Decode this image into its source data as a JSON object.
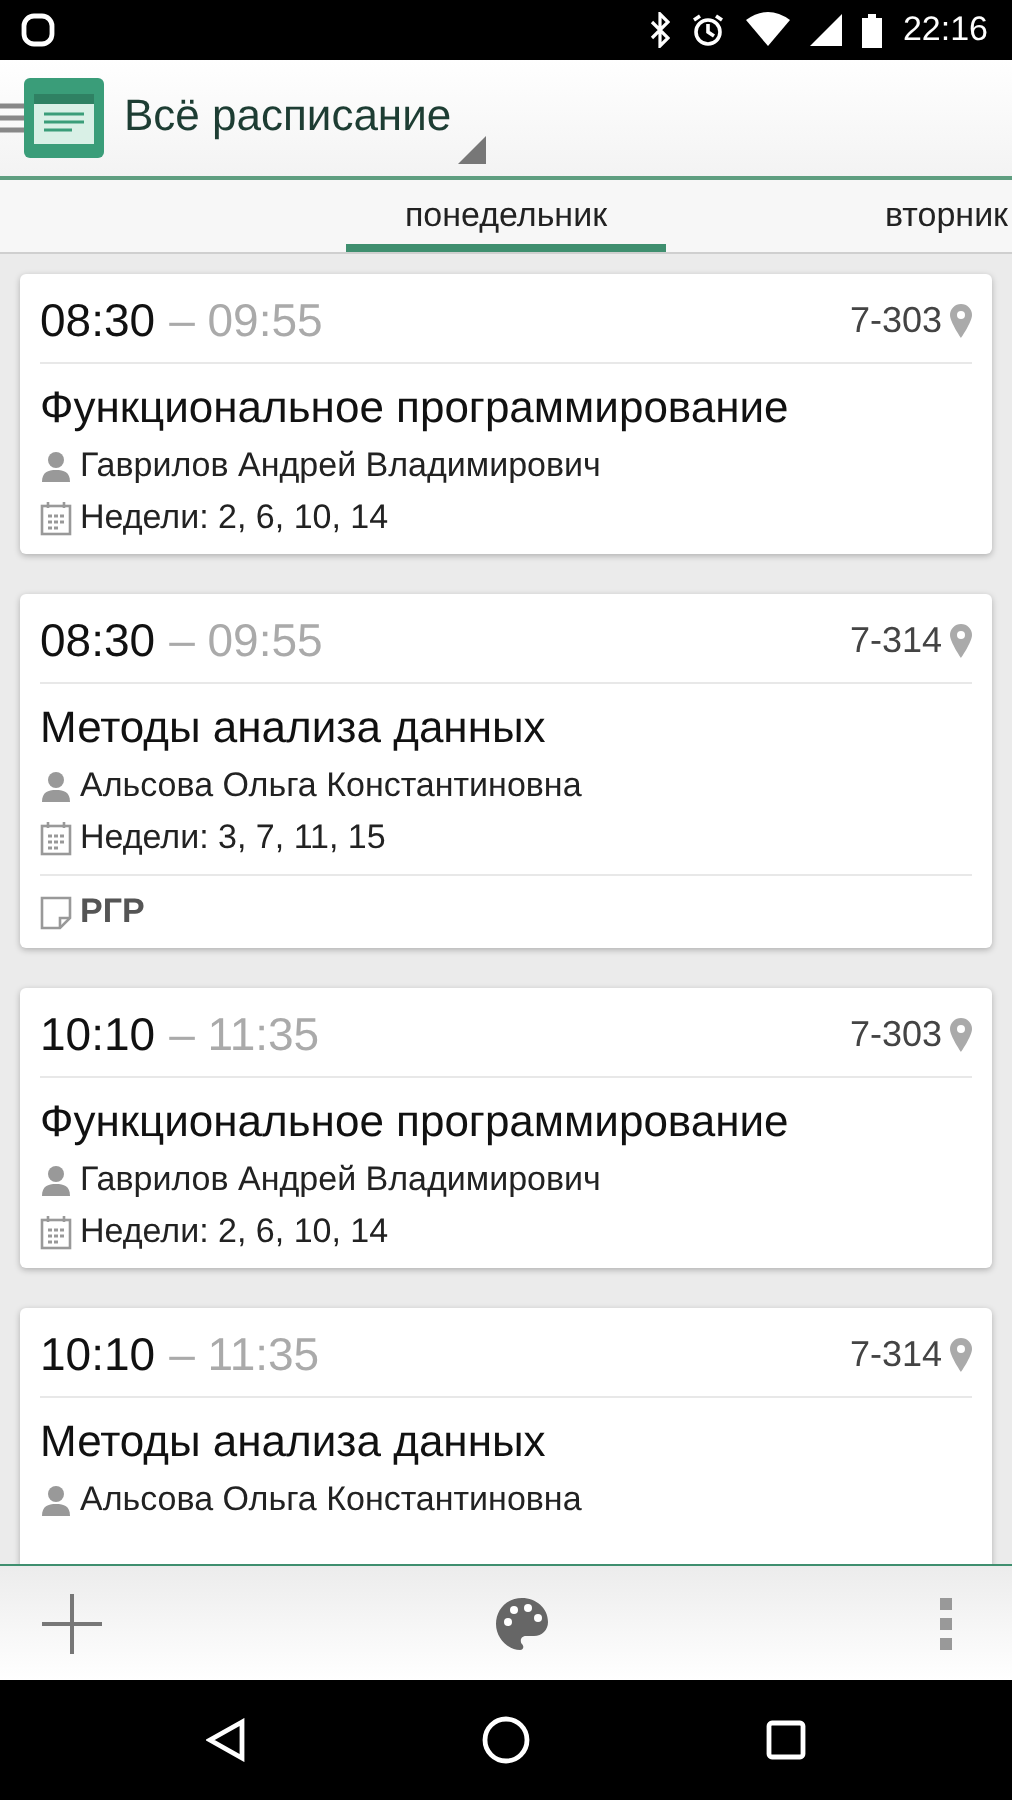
{
  "status_bar": {
    "time": "22:16"
  },
  "app_bar": {
    "title": "Всё расписание"
  },
  "tabs": [
    {
      "label": "понедельник",
      "selected": true
    },
    {
      "label": "вторник",
      "selected": false
    }
  ],
  "lessons": [
    {
      "start": "08:30",
      "end": "– 09:55",
      "room": "7-303",
      "subject": "Функциональное программирование",
      "teacher": "Гаврилов Андрей Владимирович",
      "weeks": "Недели: 2, 6, 10, 14"
    },
    {
      "start": "08:30",
      "end": "– 09:55",
      "room": "7-314",
      "subject": "Методы анализа данных",
      "teacher": "Альсова Ольга Константиновна",
      "weeks": "Недели: 3, 7, 11, 15",
      "note": "РГР"
    },
    {
      "start": "10:10",
      "end": "– 11:35",
      "room": "7-303",
      "subject": "Функциональное программирование",
      "teacher": "Гаврилов Андрей Владимирович",
      "weeks": "Недели: 2, 6, 10, 14"
    },
    {
      "start": "10:10",
      "end": "– 11:35",
      "room": "7-314",
      "subject": "Методы анализа данных",
      "teacher": "Альсова Ольга Константиновна"
    }
  ]
}
